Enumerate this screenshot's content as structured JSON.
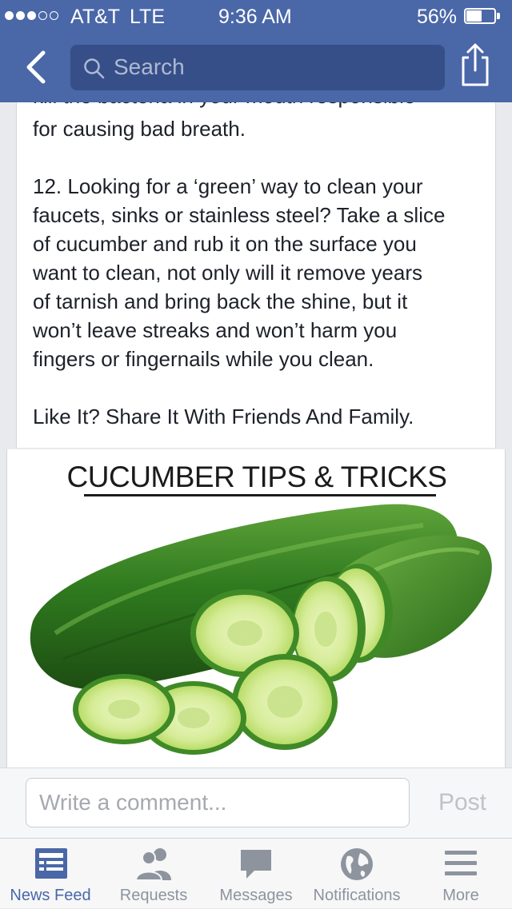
{
  "status_bar": {
    "carrier": "AT&T",
    "network": "LTE",
    "time": "9:36 AM",
    "battery_percent_text": "56%",
    "battery_level": 0.56,
    "signal_bars": 3,
    "signal_total": 5
  },
  "nav": {
    "search_placeholder": "Search"
  },
  "post": {
    "clipped_line": "kill the bacteria in your mouth responsible",
    "bad_breath_line": "for causing bad breath.",
    "tip_lines": [
      "12. Looking for a ‘green’ way to clean your",
      "faucets, sinks or stainless steel? Take a slice",
      "of cucumber and rub it on the surface you",
      "want to clean, not only will it remove years",
      "of tarnish and bring back the shine, but it",
      "won’t leave streaks and won’t harm you",
      "fingers or fingernails while you clean."
    ],
    "share_cta": "Like It? Share It With Friends And Family."
  },
  "image": {
    "title": "CUCUMBER TIPS & TRICKS"
  },
  "comment": {
    "placeholder": "Write a comment...",
    "post_label": "Post"
  },
  "tabs": [
    {
      "label": "News Feed",
      "icon": "news-feed-icon",
      "active": true
    },
    {
      "label": "Requests",
      "icon": "friend-requests-icon",
      "active": false
    },
    {
      "label": "Messages",
      "icon": "messages-icon",
      "active": false
    },
    {
      "label": "Notifications",
      "icon": "globe-icon",
      "active": false
    },
    {
      "label": "More",
      "icon": "menu-icon",
      "active": false
    }
  ],
  "colors": {
    "header_blue": "#4a67a8",
    "search_field": "#364f88",
    "tab_active": "#4a67a8",
    "tab_inactive": "#8d949e",
    "cucumber_dark": "#2f6f1f",
    "cucumber_flesh": "#d7ec9a"
  }
}
